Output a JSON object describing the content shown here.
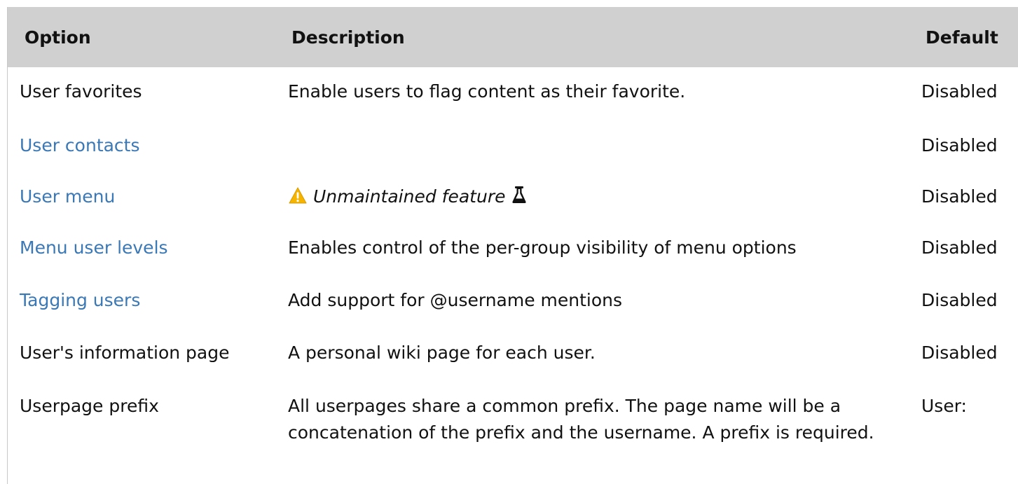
{
  "table": {
    "headers": {
      "option": "Option",
      "description": "Description",
      "default": "Default"
    },
    "rows": [
      {
        "option": "User favorites",
        "description": "Enable users to flag content as their favorite.",
        "default": "Disabled"
      },
      {
        "option": "User contacts",
        "description": "",
        "default": "Disabled"
      },
      {
        "option": "User menu",
        "description": "Unmaintained feature",
        "default": "Disabled"
      },
      {
        "option": "Menu user levels",
        "description": "Enables control of the per-group visibility of menu options",
        "default": "Disabled"
      },
      {
        "option": "Tagging users",
        "description": "Add support for @username mentions",
        "default": "Disabled"
      },
      {
        "option": "User's information page",
        "description": "A personal wiki page for each user.",
        "default": "Disabled"
      },
      {
        "option": "Userpage prefix",
        "description": "All userpages share a common prefix. The page name will be a concatenation of the prefix and the username. A prefix is required.",
        "default": "User:"
      }
    ]
  },
  "icons": {
    "warning": "warning-icon",
    "flask": "flask-icon"
  },
  "colors": {
    "header_bg": "#d0d0d0",
    "link": "#3a78b6",
    "warning": "#f5b400"
  }
}
